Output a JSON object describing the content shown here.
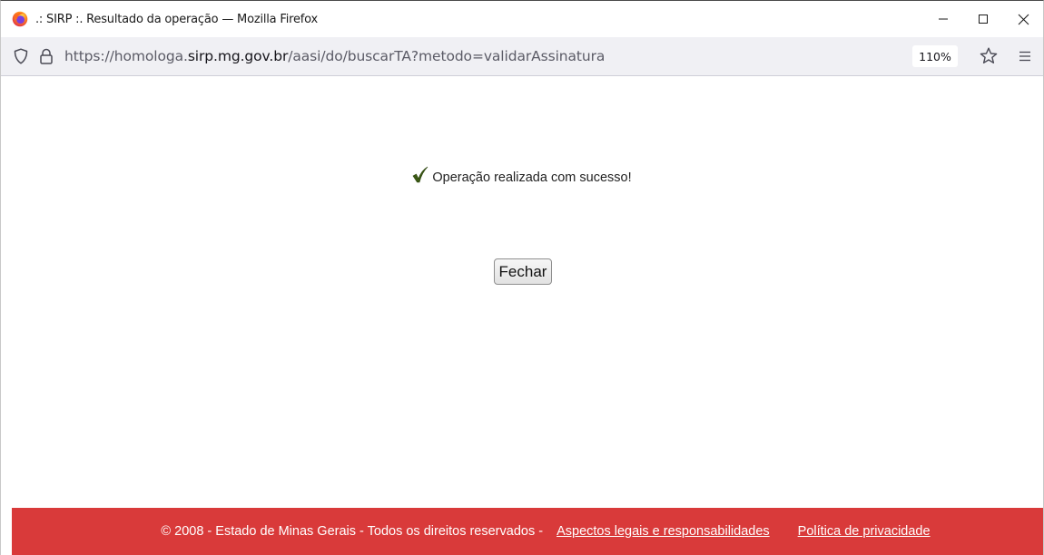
{
  "window": {
    "title": ".: SIRP :.  Resultado da operação — Mozilla Firefox"
  },
  "navbar": {
    "url_prefix": "https://homologa.",
    "url_domain": "sirp.mg.gov.br",
    "url_path": "/aasi/do/buscarTA?metodo=validarAssinatura",
    "zoom": "110%"
  },
  "content": {
    "message": "Operação realizada com sucesso!",
    "close_label": "Fechar"
  },
  "footer": {
    "copyright": "© 2008 - Estado de Minas Gerais - Todos os direitos reservados -",
    "link_legal": "Aspectos legais e responsabilidades",
    "link_privacy": "Política de privacidade"
  },
  "colors": {
    "footer_bg": "#d93a3a",
    "navbar_bg": "#f0f0f4",
    "check_green": "#3b5a14"
  },
  "icons": [
    "firefox-logo-icon",
    "minimize-icon",
    "maximize-icon",
    "close-icon",
    "shield-icon",
    "lock-icon",
    "star-icon",
    "menu-icon",
    "checkmark-icon"
  ]
}
